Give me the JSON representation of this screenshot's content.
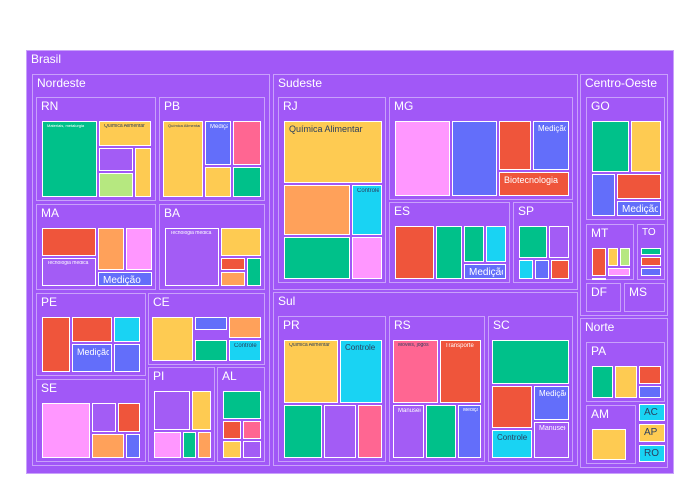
{
  "colors": {
    "group": "#a158f7",
    "purple": "#a35cf5",
    "green": "#00c18a",
    "yellow": "#fecb52",
    "pink": "#ff97ff",
    "red": "#ef553b",
    "blue": "#636efa",
    "cyan": "#19d3f3",
    "lime": "#b6e880",
    "orange": "#ffa15a",
    "salmon": "#ff6692"
  },
  "chart_data": {
    "type": "treemap",
    "root": {
      "label": "Brasil",
      "children": [
        {
          "label": "Nordeste",
          "children": [
            {
              "label": "RN",
              "children": [
                {
                  "label": "Materiais, metalurgia",
                  "color": "green",
                  "value": 10
                },
                {
                  "label": "Química Alimentar",
                  "color": "yellow",
                  "value": 3
                },
                {
                  "label": "",
                  "color": "purple",
                  "value": 1.5
                },
                {
                  "label": "",
                  "color": "yellow",
                  "value": 1.5
                },
                {
                  "label": "",
                  "color": "lime",
                  "value": 1.5
                }
              ]
            },
            {
              "label": "PB",
              "children": [
                {
                  "label": "Química Alimentar",
                  "color": "yellow",
                  "value": 5
                },
                {
                  "label": "Medição",
                  "color": "blue",
                  "value": 2.2
                },
                {
                  "label": "",
                  "color": "salmon",
                  "value": 2.2
                },
                {
                  "label": "",
                  "color": "yellow",
                  "value": 1.5
                },
                {
                  "label": "",
                  "color": "green",
                  "value": 1.5
                }
              ]
            },
            {
              "label": "MA",
              "children": [
                {
                  "label": "",
                  "color": "red",
                  "value": 4
                },
                {
                  "label": "",
                  "color": "orange",
                  "value": 1.5
                },
                {
                  "label": "",
                  "color": "pink",
                  "value": 1.5
                },
                {
                  "label": "Tecnologia médica",
                  "color": "purple",
                  "value": 4
                },
                {
                  "label": "Medição",
                  "color": "blue",
                  "value": 1.5
                }
              ]
            },
            {
              "label": "BA",
              "children": [
                {
                  "label": "Tecnologia médica",
                  "color": "purple",
                  "value": 6
                },
                {
                  "label": "",
                  "color": "yellow",
                  "value": 2
                },
                {
                  "label": "",
                  "color": "red",
                  "value": 1
                },
                {
                  "label": "",
                  "color": "orange",
                  "value": 1
                },
                {
                  "label": "",
                  "color": "green",
                  "value": 1
                }
              ]
            },
            {
              "label": "PE",
              "children": [
                {
                  "label": "",
                  "color": "red",
                  "value": 3
                },
                {
                  "label": "",
                  "color": "red",
                  "value": 3
                },
                {
                  "label": "",
                  "color": "cyan",
                  "value": 1.5
                },
                {
                  "label": "Medição",
                  "color": "blue",
                  "value": 3
                },
                {
                  "label": "",
                  "color": "blue",
                  "value": 1.5
                }
              ]
            },
            {
              "label": "CE",
              "children": [
                {
                  "label": "",
                  "color": "yellow",
                  "value": 3
                },
                {
                  "label": "",
                  "color": "blue",
                  "value": 1.5
                },
                {
                  "label": "",
                  "color": "orange",
                  "value": 1.5
                },
                {
                  "label": "",
                  "color": "green",
                  "value": 1.5
                },
                {
                  "label": "Controle",
                  "color": "cyan",
                  "value": 1.5
                }
              ]
            },
            {
              "label": "SE",
              "children": [
                {
                  "label": "",
                  "color": "pink",
                  "value": 5
                },
                {
                  "label": "",
                  "color": "purple",
                  "value": 1.5
                },
                {
                  "label": "",
                  "color": "red",
                  "value": 1.5
                },
                {
                  "label": "",
                  "color": "orange",
                  "value": 1.5
                },
                {
                  "label": "",
                  "color": "blue",
                  "value": 1
                }
              ]
            },
            {
              "label": "PI",
              "children": [
                {
                  "label": "",
                  "color": "purple",
                  "value": 3
                },
                {
                  "label": "",
                  "color": "yellow",
                  "value": 1.5
                },
                {
                  "label": "",
                  "color": "pink",
                  "value": 1
                },
                {
                  "label": "",
                  "color": "green",
                  "value": 1
                },
                {
                  "label": "",
                  "color": "orange",
                  "value": 1
                }
              ]
            },
            {
              "label": "AL",
              "children": [
                {
                  "label": "",
                  "color": "green",
                  "value": 2
                },
                {
                  "label": "",
                  "color": "red",
                  "value": 1
                },
                {
                  "label": "",
                  "color": "salmon",
                  "value": 1
                },
                {
                  "label": "",
                  "color": "yellow",
                  "value": 1
                },
                {
                  "label": "",
                  "color": "purple",
                  "value": 1
                }
              ]
            }
          ]
        },
        {
          "label": "Sudeste",
          "children": [
            {
              "label": "RJ",
              "children": [
                {
                  "label": "Química Alimentar",
                  "color": "yellow",
                  "value": 10
                },
                {
                  "label": "",
                  "color": "orange",
                  "value": 5
                },
                {
                  "label": "Controle",
                  "color": "cyan",
                  "value": 2
                },
                {
                  "label": "",
                  "color": "green",
                  "value": 4
                },
                {
                  "label": "",
                  "color": "pink",
                  "value": 2
                }
              ]
            },
            {
              "label": "MG",
              "children": [
                {
                  "label": "",
                  "color": "pink",
                  "value": 6
                },
                {
                  "label": "",
                  "color": "blue",
                  "value": 6
                },
                {
                  "label": "",
                  "color": "red",
                  "value": 3
                },
                {
                  "label": "Medição",
                  "color": "blue",
                  "value": 3
                },
                {
                  "label": "Biotecnologia",
                  "color": "red",
                  "value": 2
                }
              ]
            },
            {
              "label": "ES",
              "children": [
                {
                  "label": "",
                  "color": "red",
                  "value": 4
                },
                {
                  "label": "",
                  "color": "green",
                  "value": 3
                },
                {
                  "label": "",
                  "color": "green",
                  "value": 2
                },
                {
                  "label": "",
                  "color": "cyan",
                  "value": 2
                },
                {
                  "label": "Medição",
                  "color": "blue",
                  "value": 1.5
                }
              ]
            },
            {
              "label": "SP",
              "children": [
                {
                  "label": "",
                  "color": "green",
                  "value": 2
                },
                {
                  "label": "",
                  "color": "purple",
                  "value": 2
                },
                {
                  "label": "",
                  "color": "cyan",
                  "value": 1
                },
                {
                  "label": "",
                  "color": "blue",
                  "value": 1
                },
                {
                  "label": "",
                  "color": "red",
                  "value": 1
                }
              ]
            }
          ]
        },
        {
          "label": "Sul",
          "children": [
            {
              "label": "PR",
              "children": [
                {
                  "label": "Química Alimentar",
                  "color": "yellow",
                  "value": 5
                },
                {
                  "label": "Controle",
                  "color": "cyan",
                  "value": 4
                },
                {
                  "label": "",
                  "color": "green",
                  "value": 4
                },
                {
                  "label": "",
                  "color": "purple",
                  "value": 4
                },
                {
                  "label": "",
                  "color": "salmon",
                  "value": 2
                }
              ]
            },
            {
              "label": "RS",
              "children": [
                {
                  "label": "Móveis, jogos",
                  "color": "salmon",
                  "value": 5
                },
                {
                  "label": "Transporte",
                  "color": "red",
                  "value": 5
                },
                {
                  "label": "Manuseio",
                  "color": "purple",
                  "value": 3
                },
                {
                  "label": "",
                  "color": "green",
                  "value": 3
                },
                {
                  "label": "Medição",
                  "color": "blue",
                  "value": 2
                }
              ]
            },
            {
              "label": "SC",
              "children": [
                {
                  "label": "",
                  "color": "green",
                  "value": 8
                },
                {
                  "label": "",
                  "color": "red",
                  "value": 4
                },
                {
                  "label": "Medição",
                  "color": "blue",
                  "value": 3
                },
                {
                  "label": "Controle",
                  "color": "cyan",
                  "value": 3
                },
                {
                  "label": "Manuseio",
                  "color": "purple",
                  "value": 3
                }
              ]
            }
          ]
        },
        {
          "label": "Centro-Oeste",
          "children": [
            {
              "label": "GO",
              "children": [
                {
                  "label": "",
                  "color": "green",
                  "value": 4
                },
                {
                  "label": "",
                  "color": "yellow",
                  "value": 3
                },
                {
                  "label": "",
                  "color": "blue",
                  "value": 2
                },
                {
                  "label": "",
                  "color": "red",
                  "value": 2
                },
                {
                  "label": "Medição",
                  "color": "blue",
                  "value": 1
                }
              ]
            },
            {
              "label": "MT",
              "children": [
                {
                  "label": "",
                  "color": "red",
                  "value": 1
                },
                {
                  "label": "",
                  "color": "yellow",
                  "value": 1
                },
                {
                  "label": "",
                  "color": "lime",
                  "value": 1
                },
                {
                  "label": "",
                  "color": "pink",
                  "value": 1
                },
                {
                  "label": "",
                  "color": "salmon",
                  "value": 0.5
                }
              ]
            },
            {
              "label": "TO",
              "children": [
                {
                  "label": "",
                  "color": "green",
                  "value": 1
                },
                {
                  "label": "",
                  "color": "red",
                  "value": 1
                },
                {
                  "label": "",
                  "color": "blue",
                  "value": 1
                }
              ]
            },
            {
              "label": "DF",
              "children": []
            },
            {
              "label": "MS",
              "children": []
            }
          ]
        },
        {
          "label": "Norte",
          "children": [
            {
              "label": "PA",
              "children": [
                {
                  "label": "",
                  "color": "green",
                  "value": 1.5
                },
                {
                  "label": "",
                  "color": "yellow",
                  "value": 1.5
                },
                {
                  "label": "",
                  "color": "red",
                  "value": 1
                },
                {
                  "label": "",
                  "color": "blue",
                  "value": 1
                }
              ]
            },
            {
              "label": "AM",
              "children": [
                {
                  "label": "",
                  "color": "yellow",
                  "value": 3
                }
              ]
            },
            {
              "label": "AC",
              "color": "cyan",
              "children": []
            },
            {
              "label": "AP",
              "color": "yellow",
              "children": []
            },
            {
              "label": "RO",
              "color": "cyan",
              "children": []
            }
          ]
        }
      ]
    }
  }
}
